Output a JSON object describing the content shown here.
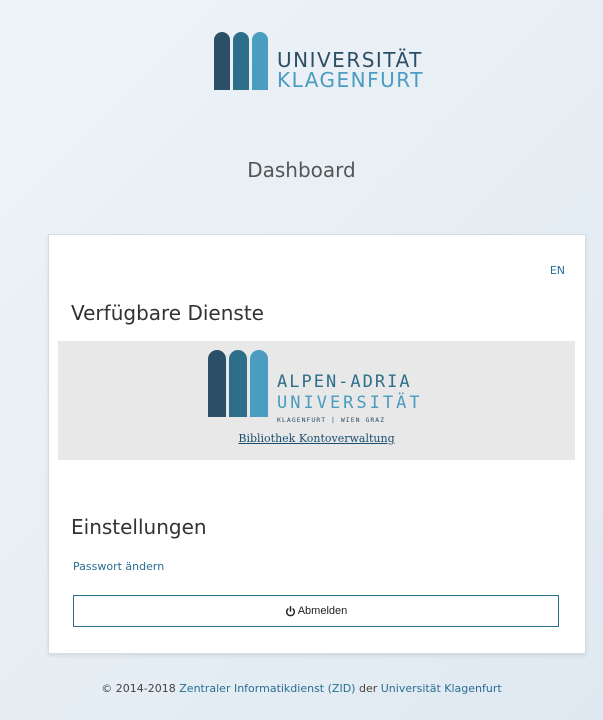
{
  "header": {
    "logo_line1": "UNIVERSITÄT",
    "logo_line2": "KLAGENFURT",
    "title": "Dashboard"
  },
  "card": {
    "lang_switch": "EN",
    "services_heading": "Verfügbare Dienste",
    "service": {
      "logo_line1": "ALPEN-ADRIA",
      "logo_line2": "UNIVERSITÄT",
      "logo_line3": "KLAGENFURT | WIEN GRAZ",
      "link_label": "Bibliothek Kontoverwaltung"
    },
    "settings_heading": "Einstellungen",
    "password_link": "Passwort ändern",
    "logout_label": "Abmelden"
  },
  "footer": {
    "prefix": "© 2014-2018",
    "zid_link": "Zentraler Informatikdienst (ZID)",
    "middle": "der",
    "uni_link": "Universität Klagenfurt"
  },
  "colors": {
    "brand_dark": "#2b4f66",
    "brand_mid": "#2d6f8a",
    "brand_light": "#4a9cc0",
    "link": "#2a6e92"
  },
  "icons": {
    "logout": "power-icon"
  }
}
